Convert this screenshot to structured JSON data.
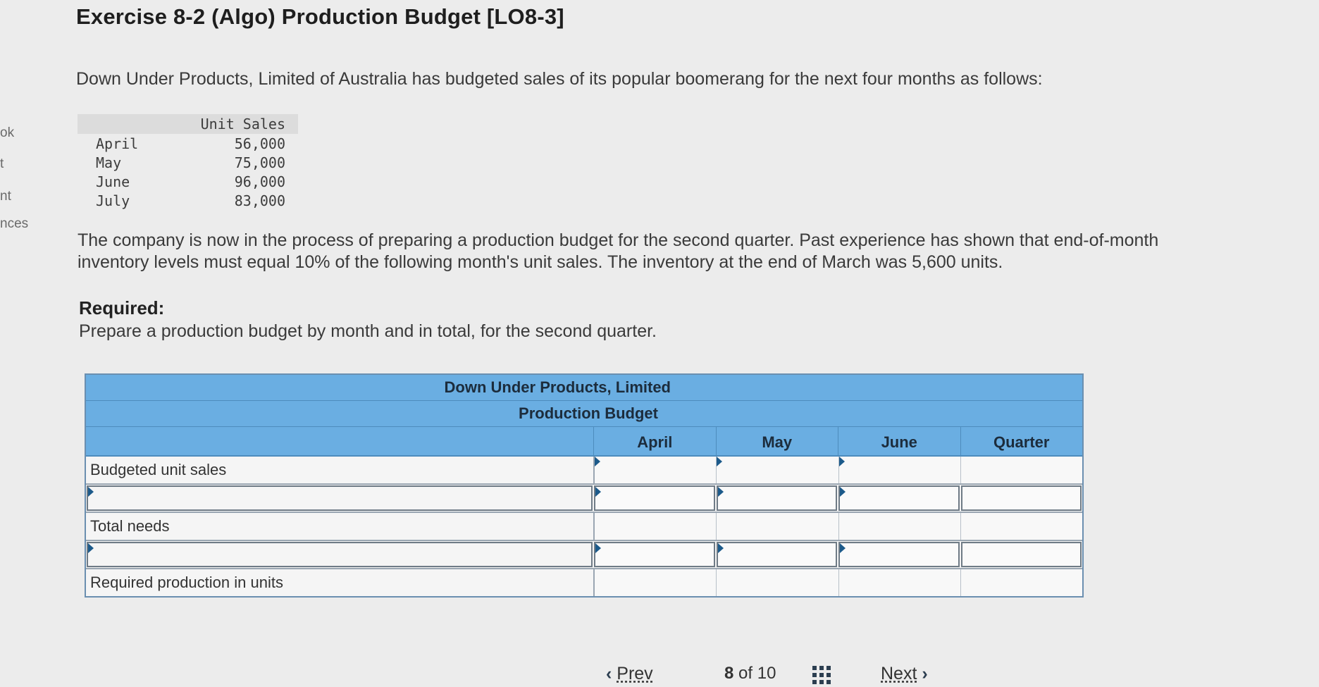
{
  "side_nav": [
    "ok",
    "t",
    "nt",
    "nces"
  ],
  "title": "Exercise 8-2 (Algo) Production Budget [LO8-3]",
  "intro": "Down Under Products, Limited of Australia has budgeted sales of its popular boomerang for the next four months as follows:",
  "sales": {
    "header": "Unit Sales",
    "rows": [
      {
        "month": "April",
        "value": "56,000"
      },
      {
        "month": "May",
        "value": "75,000"
      },
      {
        "month": "June",
        "value": "96,000"
      },
      {
        "month": "July",
        "value": "83,000"
      }
    ]
  },
  "paragraph": "The company is now in the process of preparing a production budget for the second quarter. Past experience has shown that end-of-month inventory levels must equal 10% of the following month's unit sales. The inventory at the end of March was 5,600 units.",
  "required": {
    "heading": "Required:",
    "text": "Prepare a production budget by month and in total, for the second quarter."
  },
  "budget": {
    "company": "Down Under Products, Limited",
    "name": "Production Budget",
    "columns": [
      "April",
      "May",
      "June",
      "Quarter"
    ],
    "rows": [
      {
        "label": "Budgeted unit sales",
        "editable_label": false
      },
      {
        "label": "",
        "editable_label": true
      },
      {
        "label": "Total needs",
        "editable_label": false
      },
      {
        "label": "",
        "editable_label": true
      },
      {
        "label": "Required production in units",
        "editable_label": false
      }
    ]
  },
  "nav": {
    "prev": "Prev",
    "current": "8",
    "of": "of",
    "total": "10",
    "next": "Next"
  }
}
